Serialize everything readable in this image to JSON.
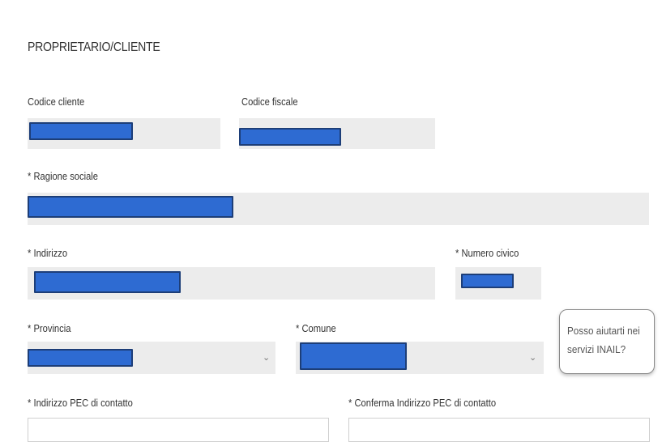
{
  "section": {
    "title": "PROPRIETARIO/CLIENTE"
  },
  "fields": {
    "codice_cliente": {
      "label": "Codice cliente"
    },
    "codice_fiscale": {
      "label": "Codice fiscale"
    },
    "ragione_sociale": {
      "label": "* Ragione sociale"
    },
    "indirizzo": {
      "label": "* Indirizzo"
    },
    "numero_civico": {
      "label": "* Numero civico"
    },
    "provincia": {
      "label": "* Provincia"
    },
    "comune": {
      "label": "* Comune"
    },
    "indirizzo_pec": {
      "label": "* Indirizzo PEC di contatto"
    },
    "conferma_pec": {
      "label": "* Conferma Indirizzo PEC di contatto"
    }
  },
  "chat": {
    "line1": "Posso aiutarti nei",
    "line2": "servizi INAIL?"
  },
  "colors": {
    "redaction": "#2e6bd2",
    "field_bg": "#ececec"
  }
}
